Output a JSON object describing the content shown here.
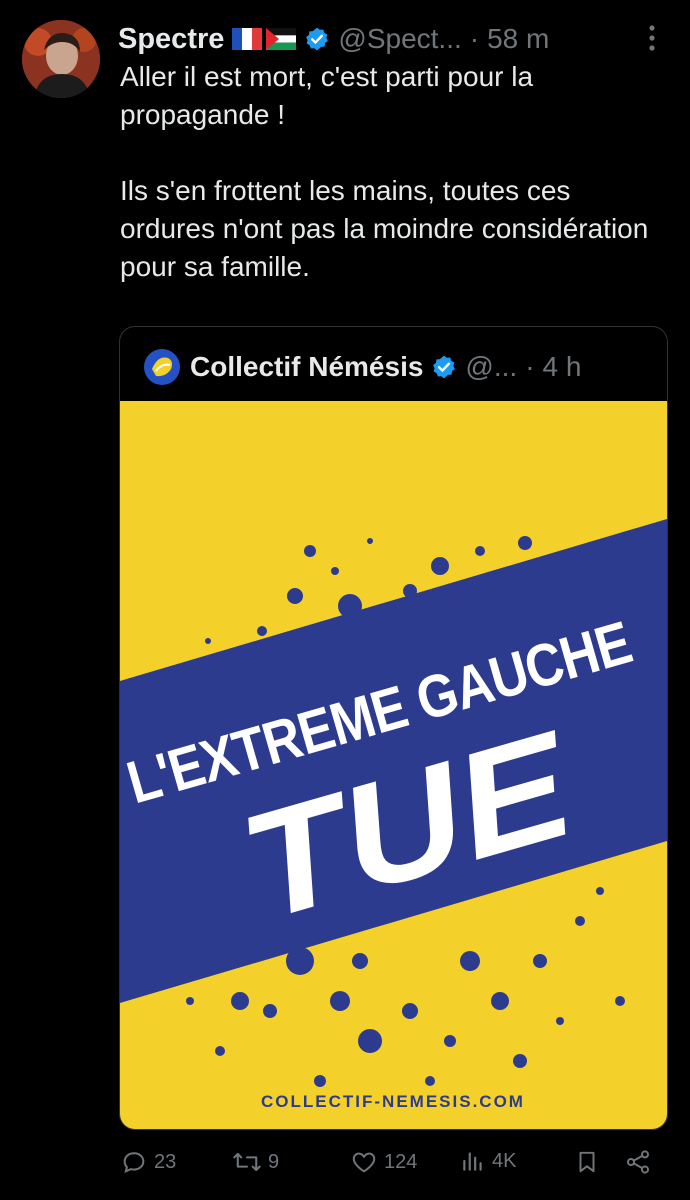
{
  "author": {
    "name": "Spectre",
    "handle": "@Spect...",
    "separator": "·",
    "time": "58 m",
    "flags": [
      "france-flag-icon",
      "palestine-flag-icon"
    ],
    "verified": true
  },
  "tweet": {
    "paragraphs": [
      "Aller il est mort, c'est parti pour la propagande !",
      "Ils s'en frottent les mains, toutes ces ordures n'ont pas la moindre considération pour sa famille."
    ]
  },
  "quoted": {
    "name": "Collectif Némésis",
    "handle": "@...",
    "separator": "·",
    "time": "4 h",
    "verified": true,
    "image": {
      "headline": "L'EXTREME GAUCHE",
      "big_word": "TUE",
      "footer": "COLLECTIF-NEMESIS.COM",
      "colors": {
        "yellow": "#f4d12a",
        "blue": "#2d3b8f",
        "white": "#ffffff"
      }
    }
  },
  "actions": {
    "reply_count": "23",
    "retweet_count": "9",
    "like_count": "124",
    "views_count": "4K"
  },
  "colors": {
    "background": "#000000",
    "text": "#e7e9ea",
    "secondary": "#71767b",
    "verified": "#1d9bf0",
    "border": "#2f3336"
  }
}
